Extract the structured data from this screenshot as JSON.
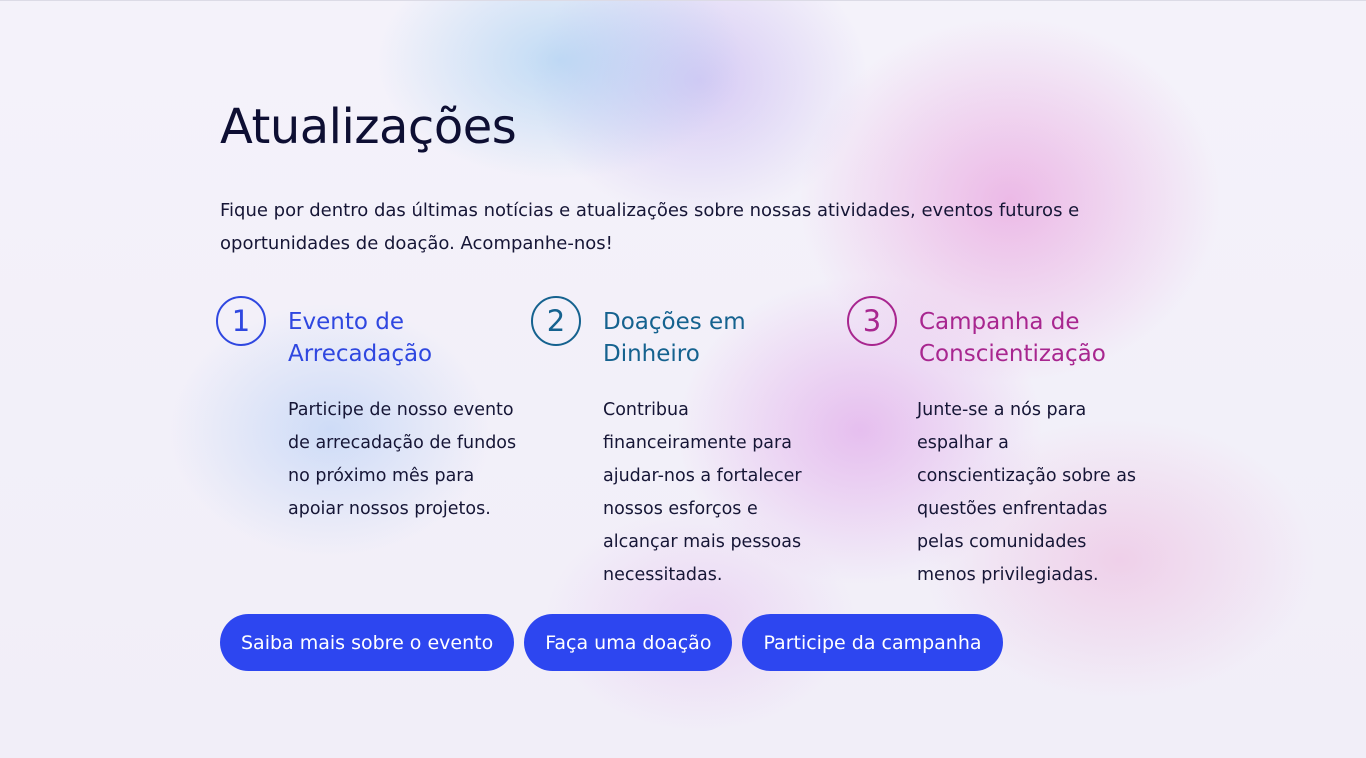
{
  "section": {
    "title": "Atualizações",
    "intro": "Fique por dentro das últimas notícias e atualizações sobre nossas atividades, eventos futuros e oportunidades de doação. Acompanhe-nos!"
  },
  "cards": [
    {
      "number": "1",
      "title": "Evento de Arrecadação",
      "text": "Participe de nosso evento de arrecadação de fundos no próximo mês para apoiar nossos projetos.",
      "color": "#2f47e0"
    },
    {
      "number": "2",
      "title": "Doações em Dinheiro",
      "text": "Contribua financeiramente para ajudar-nos a fortalecer nossos esforços e alcançar mais pessoas necessitadas.",
      "color": "#15628f"
    },
    {
      "number": "3",
      "title": "Campanha de Conscientização",
      "text": "Junte-se a nós para espalhar a conscientização sobre as questões enfrentadas pelas comunidades menos privilegiadas.",
      "color": "#a8268f"
    }
  ],
  "buttons": {
    "event": "Saiba mais sobre o evento",
    "donate": "Faça uma doação",
    "campaign": "Participe da campanha",
    "color": "#2d46f0"
  }
}
